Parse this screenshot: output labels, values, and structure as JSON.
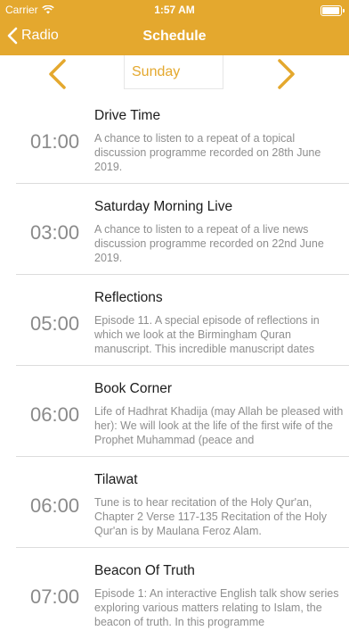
{
  "status_bar": {
    "carrier": "Carrier",
    "time": "1:57 AM",
    "battery_level": 1.0
  },
  "nav": {
    "back_label": "Radio",
    "title": "Schedule"
  },
  "day_selector": {
    "day": "Sunday"
  },
  "programmes": [
    {
      "time": "01:00",
      "title": "Drive Time",
      "description": "A chance to listen to a repeat of a topical discussion programme recorded on 28th June 2019."
    },
    {
      "time": "03:00",
      "title": "Saturday Morning Live",
      "description": "A chance to listen to a repeat of a live news discussion programme recorded on 22nd June 2019."
    },
    {
      "time": "05:00",
      "title": "Reflections",
      "description": "Episode 11. A special episode of reflections in which we look at the Birmingham Quran manuscript. This incredible manuscript dates"
    },
    {
      "time": "06:00",
      "title": "Book Corner",
      "description": "Life of Hadhrat Khadija (may Allah be pleased with her): We will look at the life of the first wife of the Prophet Muhammad (peace and"
    },
    {
      "time": "06:00",
      "title": "Tilawat",
      "description": "Tune is to hear recitation of the Holy Qur'an, Chapter 2 Verse 117-135 Recitation of the Holy Qur'an is by Maulana Feroz Alam."
    },
    {
      "time": "07:00",
      "title": "Beacon Of Truth",
      "description": "Episode 1: An interactive English talk show series exploring various matters relating to Islam, the beacon of truth. In this programme"
    }
  ]
}
